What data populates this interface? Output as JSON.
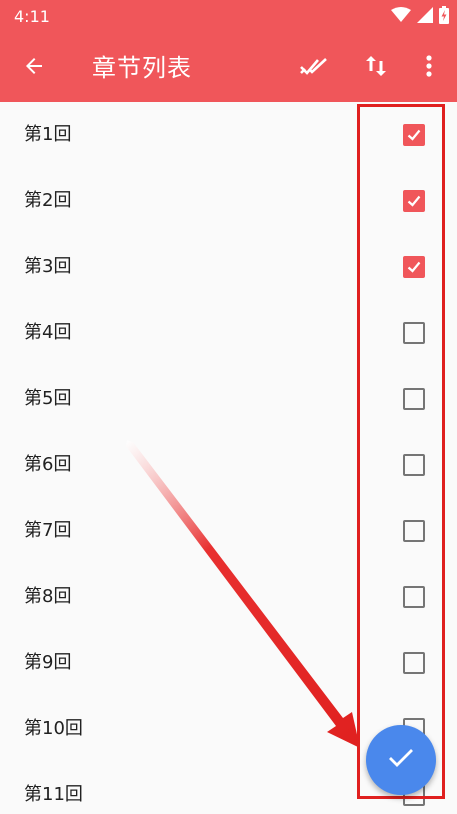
{
  "status_bar": {
    "time": "4:11",
    "icons": [
      "wifi-icon",
      "signal-icon",
      "battery-charging-icon"
    ]
  },
  "app_bar": {
    "title": "章节列表",
    "back_icon": "arrow-left-icon",
    "actions": [
      "select-all-icon",
      "sort-icon",
      "more-vert-icon"
    ]
  },
  "chapters": [
    {
      "label": "第1回",
      "checked": true
    },
    {
      "label": "第2回",
      "checked": true
    },
    {
      "label": "第3回",
      "checked": true
    },
    {
      "label": "第4回",
      "checked": false
    },
    {
      "label": "第5回",
      "checked": false
    },
    {
      "label": "第6回",
      "checked": false
    },
    {
      "label": "第7回",
      "checked": false
    },
    {
      "label": "第8回",
      "checked": false
    },
    {
      "label": "第9回",
      "checked": false
    },
    {
      "label": "第10回",
      "checked": false
    },
    {
      "label": "第11回",
      "checked": false
    }
  ],
  "fab": {
    "icon": "check-icon"
  },
  "colors": {
    "primary": "#f0565a",
    "fab": "#4a88ec",
    "annotation": "#e0201f"
  }
}
